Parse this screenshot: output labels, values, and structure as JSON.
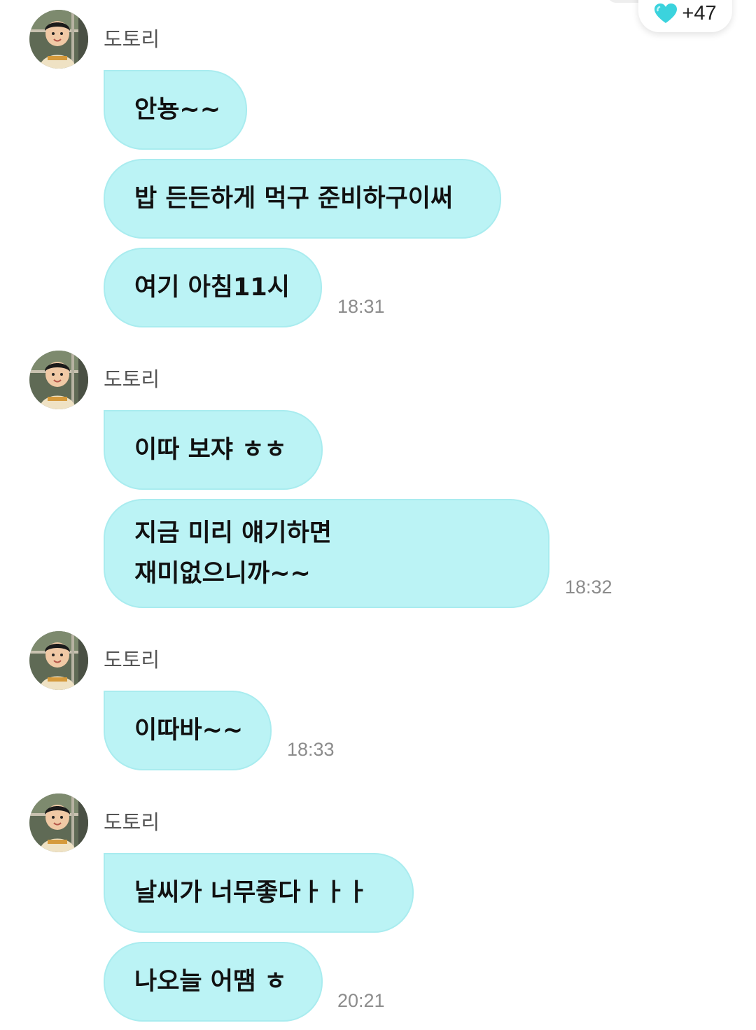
{
  "reaction": {
    "icon": "heart-icon",
    "color": "#3bd3dd",
    "count": "+47"
  },
  "colors": {
    "bubble": "#bbf3f5",
    "bubble_border": "#a9ecef",
    "sender_text": "#555555",
    "time_text": "#8c8c8c"
  },
  "groups": [
    {
      "sender": "도토리",
      "messages": [
        "안뇽~~",
        "밥 든든하게 먹구 준비하구이써",
        "여기 아침11시"
      ],
      "time": "18:31"
    },
    {
      "sender": "도토리",
      "messages": [
        "이따 보쟈 ㅎㅎ",
        "지금 미리 얘기하면\n재미없으니까~~"
      ],
      "time": "18:32"
    },
    {
      "sender": "도토리",
      "messages": [
        "이따바~~"
      ],
      "time": "18:33"
    },
    {
      "sender": "도토리",
      "messages": [
        "날씨가 너무좋다ㅏㅏㅏ",
        "나오늘 어땜 ㅎ"
      ],
      "time": "20:21"
    }
  ]
}
